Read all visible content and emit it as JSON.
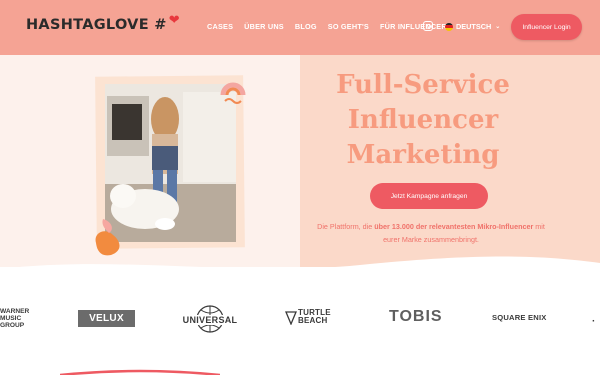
{
  "header": {
    "logo_text": "HASHTAGLOVE #",
    "nav": [
      "CASES",
      "ÜBER UNS",
      "BLOG",
      "SO GEHT'S",
      "FÜR INFLUENCER"
    ],
    "language": "DEUTSCH",
    "login_label": "Influencer Login"
  },
  "hero": {
    "headline_lines": [
      "Full-Service",
      "Influencer",
      "Marketing"
    ],
    "cta_label": "Jetzt Kampagne anfragen",
    "description": {
      "pre": "Die Plattform, die ",
      "bold": "über 13.000 der relevantesten Mikro-Influencer",
      "post": " mit eurer Marke zusammenbringt."
    }
  },
  "brands": {
    "warner": [
      "WARNER",
      "MUSIC",
      "GROUP"
    ],
    "velux": "VELUX",
    "universal": "UNIVERSAL",
    "turtle_beach": [
      "TURTLE",
      "BEACH"
    ],
    "tobis": "TOBIS",
    "square_enix": "SQUARE ENIX"
  },
  "colors": {
    "header_bg": "#f5a394",
    "accent": "#ee5a62",
    "headline": "#f79b7f",
    "hero_right_bg": "#fbd9c9"
  },
  "icons": [
    "heart-icon",
    "instagram-icon",
    "germany-flag-icon",
    "chevron-down-icon"
  ]
}
